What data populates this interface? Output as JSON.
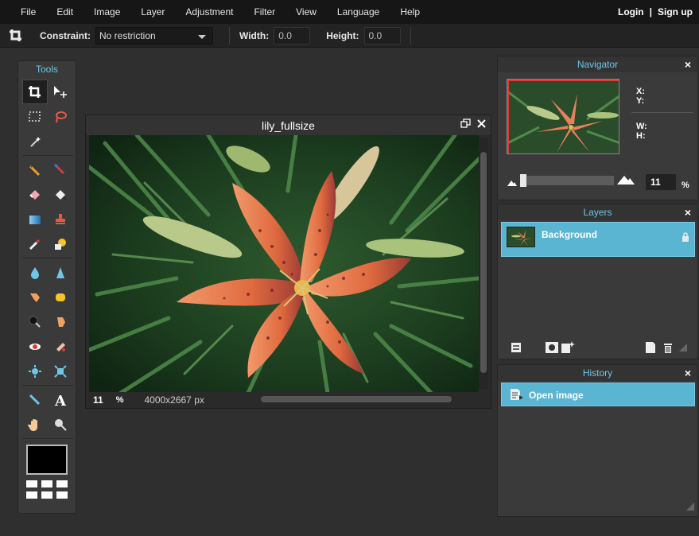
{
  "menubar": {
    "items": [
      "File",
      "Edit",
      "Image",
      "Layer",
      "Adjustment",
      "Filter",
      "View",
      "Language",
      "Help"
    ],
    "login": "Login",
    "separator": "|",
    "signup": "Sign up"
  },
  "toolbar": {
    "constraint_label": "Constraint:",
    "constraint_value": "No restriction",
    "width_label": "Width:",
    "width_value": "0.0",
    "height_label": "Height:",
    "height_value": "0.0"
  },
  "tools": {
    "title": "Tools",
    "active_tool": "crop-icon",
    "primary_color": "#000000",
    "secondary_color": "#ffffff"
  },
  "image_window": {
    "title": "lily_fullsize",
    "zoom": "11",
    "zoom_unit": "%",
    "dimensions": "4000x2667 px"
  },
  "navigator": {
    "title": "Navigator",
    "x_label": "X:",
    "y_label": "Y:",
    "w_label": "W:",
    "h_label": "H:",
    "zoom_value": "11",
    "zoom_unit": "%",
    "zoom_level": 0.11
  },
  "layers": {
    "title": "Layers",
    "items": [
      {
        "name": "Background",
        "locked": true
      }
    ]
  },
  "history": {
    "title": "History",
    "items": [
      "Open image"
    ]
  },
  "colors": {
    "accent": "#6ec6e8",
    "selection": "#5ab5d3"
  }
}
